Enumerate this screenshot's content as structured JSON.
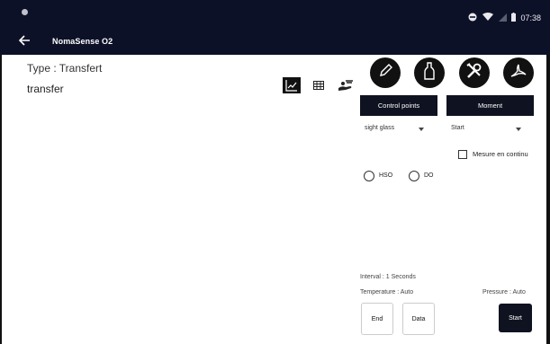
{
  "status_bar": {
    "time": "07:38",
    "icons": [
      "dnd-icon",
      "wifi-icon",
      "signal-icon",
      "battery-icon"
    ]
  },
  "app_bar": {
    "title": "NomaSense O2",
    "back_icon": "arrow-left-icon"
  },
  "main": {
    "type_line": "Type : Transfert",
    "subtype": "transfer",
    "view_icons": [
      "chart-icon",
      "table-icon",
      "hand-icon"
    ]
  },
  "tools": {
    "buttons": [
      "pen-icon",
      "bottle-icon",
      "tools-icon",
      "pdf-icon"
    ],
    "control_points_label": "Control points",
    "moment_label": "Moment",
    "control_point_value": "sight glass",
    "moment_value": "Start",
    "continuous_label": "Mesure en continu",
    "radio_options": [
      "HSO",
      "DO"
    ]
  },
  "info": {
    "interval": "Interval : 1 Seconds",
    "temperature": "Temperature : Auto",
    "pressure": "Pressure : Auto"
  },
  "actions": {
    "end_label": "End",
    "data_label": "Data",
    "start_label": "Start"
  },
  "colors": {
    "bar": "#0d1128",
    "button": "#0f1220"
  }
}
